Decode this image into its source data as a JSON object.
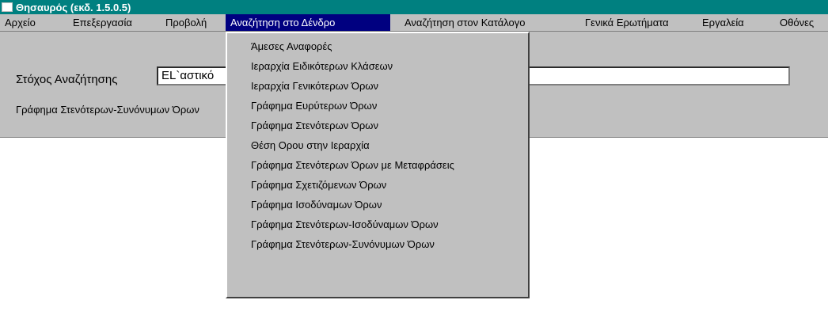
{
  "window": {
    "title": "Θησαυρός (εκδ. 1.5.0.5)"
  },
  "menubar": {
    "items": [
      "Αρχείο",
      "Επεξεργασία",
      "Προβολή",
      "Αναζήτηση στο Δένδρο",
      "Αναζήτηση στον Κατάλογο",
      "Γενικά Ερωτήματα",
      "Εργαλεία",
      "Οθόνες"
    ],
    "active_index": 3
  },
  "search": {
    "label": "Στόχος Αναζήτησης",
    "value": "EL`αστικό"
  },
  "graph": {
    "label": "Γράφημα Στενότερων-Συνόνυμων Όρων"
  },
  "dropdown": {
    "items": [
      "Άμεσες Αναφορές",
      "Ιεραρχία Ειδικότερων Κλάσεων",
      "Ιεραρχία Γενικότερων Όρων",
      "Γράφημα Ευρύτερων Όρων",
      "Γράφημα Στενότερων Όρων",
      "Θέση Ορου στην Ιεραρχία",
      "Γράφημα Στενότερων Όρων με Μεταφράσεις",
      "Γράφημα Σχετιζόμενων Όρων",
      "Γράφημα Ισοδύναμων Όρων",
      "Γράφημα Στενότερων-Ισοδύναμων Όρων",
      "Γράφημα Στενότερων-Συνόνυμων Όρων"
    ]
  },
  "colors": {
    "titlebar": "#008080",
    "menu_highlight": "#000080",
    "face": "#c0c0c0"
  }
}
